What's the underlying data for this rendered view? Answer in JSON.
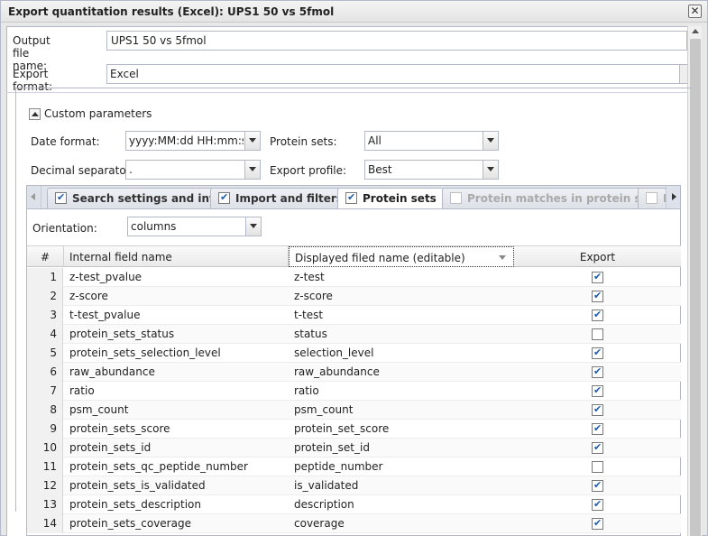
{
  "window": {
    "title": "Export quantitation results (Excel): UPS1 50 vs 5fmol",
    "close_glyph": "✕"
  },
  "form": {
    "output_label": "Output file name:",
    "output_value": "UPS1 50 vs 5fmol",
    "format_label": "Export format:",
    "format_value": "Excel"
  },
  "custom": {
    "legend": "Custom parameters",
    "date_format_label": "Date format:",
    "date_format_value": "yyyy:MM:dd HH:mm:ss",
    "protein_sets_label": "Protein sets:",
    "protein_sets_value": "All",
    "decimal_label": "Decimal separator:",
    "decimal_value": ".",
    "profile_label": "Export profile:",
    "profile_value": "Best"
  },
  "tabs": [
    {
      "label": "Search settings and infos",
      "checked": true,
      "active": false,
      "disabled": false
    },
    {
      "label": "Import and filters",
      "checked": true,
      "active": false,
      "disabled": false
    },
    {
      "label": "Protein sets",
      "checked": true,
      "active": true,
      "disabled": false
    },
    {
      "label": "Protein matches in protein sets",
      "checked": false,
      "active": false,
      "disabled": true
    },
    {
      "label": "P",
      "checked": false,
      "active": false,
      "disabled": true
    }
  ],
  "panel": {
    "orientation_label": "Orientation:",
    "orientation_value": "columns"
  },
  "grid": {
    "headers": {
      "num": "#",
      "internal": "Internal field name",
      "displayed": "Displayed filed name (editable)",
      "export": "Export"
    },
    "rows": [
      {
        "n": "1",
        "internal": "z-test_pvalue",
        "displayed": "z-test",
        "export": true
      },
      {
        "n": "2",
        "internal": "z-score",
        "displayed": "z-score",
        "export": true
      },
      {
        "n": "3",
        "internal": "t-test_pvalue",
        "displayed": "t-test",
        "export": true
      },
      {
        "n": "4",
        "internal": "protein_sets_status",
        "displayed": "status",
        "export": false
      },
      {
        "n": "5",
        "internal": "protein_sets_selection_level",
        "displayed": "selection_level",
        "export": true
      },
      {
        "n": "6",
        "internal": "raw_abundance",
        "displayed": "raw_abundance",
        "export": true
      },
      {
        "n": "7",
        "internal": "ratio",
        "displayed": "ratio",
        "export": true
      },
      {
        "n": "8",
        "internal": "psm_count",
        "displayed": "psm_count",
        "export": true
      },
      {
        "n": "9",
        "internal": "protein_sets_score",
        "displayed": "protein_set_score",
        "export": true
      },
      {
        "n": "10",
        "internal": "protein_sets_id",
        "displayed": "protein_set_id",
        "export": true
      },
      {
        "n": "11",
        "internal": "protein_sets_qc_peptide_number",
        "displayed": "peptide_number",
        "export": false
      },
      {
        "n": "12",
        "internal": "protein_sets_is_validated",
        "displayed": "is_validated",
        "export": true
      },
      {
        "n": "13",
        "internal": "protein_sets_description",
        "displayed": "description",
        "export": true
      },
      {
        "n": "14",
        "internal": "protein_sets_coverage",
        "displayed": "coverage",
        "export": true
      }
    ]
  }
}
